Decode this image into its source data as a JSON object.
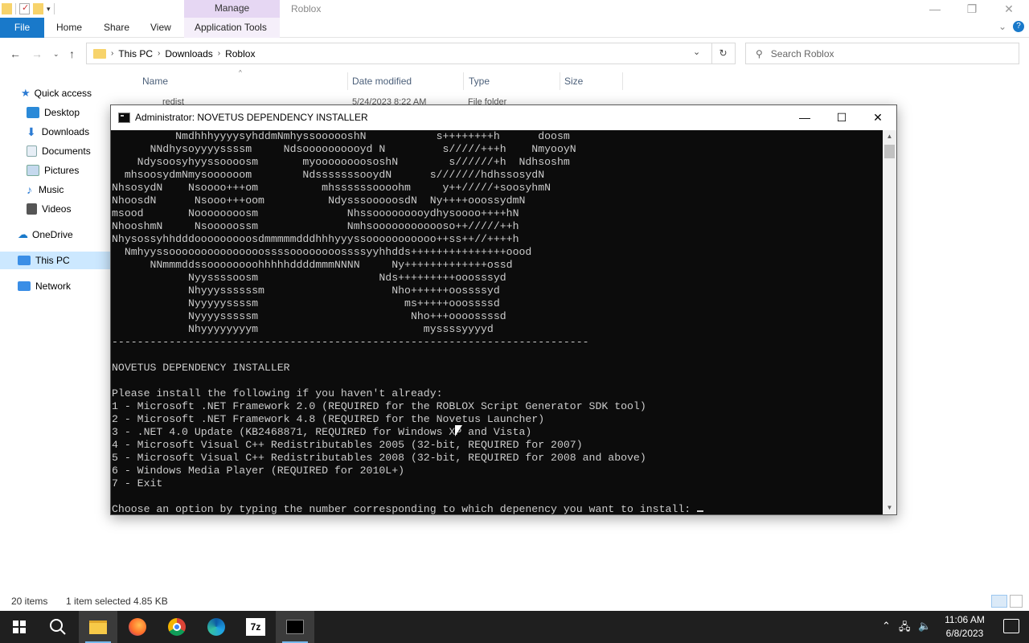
{
  "explorer": {
    "context_tab": "Manage",
    "title": "Roblox",
    "ribbon": {
      "file": "File",
      "home": "Home",
      "share": "Share",
      "view": "View",
      "app_tools": "Application Tools"
    },
    "breadcrumb": [
      "This PC",
      "Downloads",
      "Roblox"
    ],
    "search_placeholder": "Search Roblox",
    "nav": {
      "quick_access": "Quick access",
      "desktop": "Desktop",
      "downloads": "Downloads",
      "documents": "Documents",
      "pictures": "Pictures",
      "music": "Music",
      "videos": "Videos",
      "onedrive": "OneDrive",
      "this_pc": "This PC",
      "network": "Network"
    },
    "columns": {
      "name": "Name",
      "date": "Date modified",
      "type": "Type",
      "size": "Size"
    },
    "row_partial": {
      "name": "redist",
      "date": "5/24/2023 8:22 AM",
      "type": "File folder"
    },
    "status": {
      "items": "20 items",
      "selected": "1 item selected  4.85 KB"
    }
  },
  "console": {
    "title": "Administrator:  NOVETUS DEPENDENCY INSTALLER",
    "lines": [
      "          NmdhhhyyyysyhddmNmhyssoooooshN           s++++++++h      doosm",
      "      NNdhysoyyyyssssm     Ndsoooooooooyd N         s/////+++h    NmyooyN",
      "    Ndysoosyhyyssoooosm       myoooooooososhN        s//////+h  Ndhsoshm",
      "  mhsoosydmNmysoooooom        NdsssssssooydN      s///////hdhssosydN",
      "NhsosydN    Nsoooo+++om          mhssssssoooohm     y++/////+soosyhmN",
      "NhoosdN      Nsooo+++oom          NdysssooooosdN  Ny++++ooossydmN",
      "msood       Noooooooosm              Nhssooooooooydhysoooo++++hN",
      "NhooshmN     Nsooooossm              Nmhsoooooooooooso++/////++h",
      "Nhysossyhhdddooooooooosdmmmmmdddhhhyyyssooooooooooo++ss++//++++h",
      "  Nmhyyssooooooooooooooossssoooooooossssyyhhdds+++++++++++++++oood",
      "      NNmmmddssoooooooohhhhhddddmmmNNNN     Ny+++++++++++++ossd",
      "            Nyyssssoosm                   Nds+++++++++ooosssyd",
      "            Nhyyyssssssm                    Nho++++++oossssyd",
      "            Nyyyyyssssm                       ms+++++ooossssd",
      "            Nyyyysssssm                        Nho+++oooossssd",
      "            Nhyyyyyyyym                          myssssyyyyd",
      "---------------------------------------------------------------------------",
      "",
      "NOVETUS DEPENDENCY INSTALLER",
      "",
      "Please install the following if you haven't already:",
      "1 - Microsoft .NET Framework 2.0 (REQUIRED for the ROBLOX Script Generator SDK tool)",
      "2 - Microsoft .NET Framework 4.8 (REQUIRED for the Novetus Launcher)",
      "3 - .NET 4.0 Update (KB2468871, REQUIRED for Windows XP and Vista)",
      "4 - Microsoft Visual C++ Redistributables 2005 (32-bit, REQUIRED for 2007)",
      "5 - Microsoft Visual C++ Redistributables 2008 (32-bit, REQUIRED for 2008 and above)",
      "6 - Windows Media Player (REQUIRED for 2010L+)",
      "7 - Exit",
      "",
      "Choose an option by typing the number corresponding to which depenency you want to install: "
    ]
  },
  "taskbar": {
    "time": "11:06 AM",
    "date": "6/8/2023",
    "apps": [
      "start-icon",
      "search-icon",
      "file-explorer-icon",
      "firefox-icon",
      "chrome-icon",
      "edge-icon",
      "7zip-icon",
      "cmd-icon"
    ],
    "sevenzip_label": "7z"
  },
  "colors": {
    "accent": "#1979ca",
    "console_bg": "#0c0c0c",
    "console_fg": "#cccccc",
    "taskbar_bg": "#1f1f1f"
  }
}
